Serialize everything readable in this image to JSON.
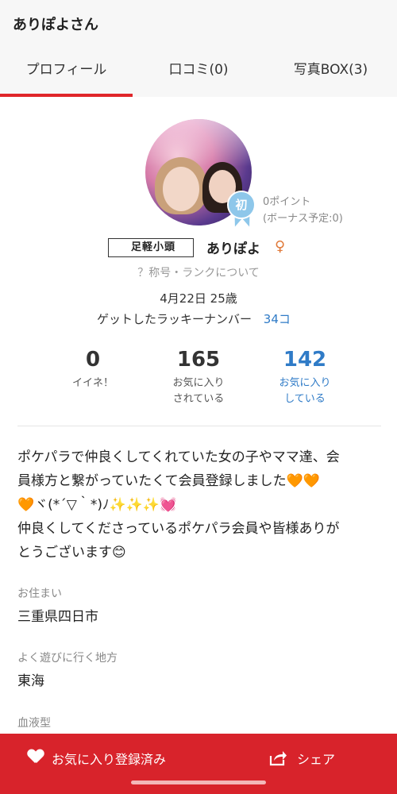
{
  "header": {
    "title": "ありぽよさん"
  },
  "tabs": [
    {
      "label": "プロフィール",
      "active": true
    },
    {
      "label": "口コミ(0)",
      "active": false
    },
    {
      "label": "写真BOX(3)",
      "active": false
    }
  ],
  "profile": {
    "badge_char": "初",
    "points": "0ポイント",
    "bonus": "(ボーナス予定:0)",
    "title_badge": "足軽小頭",
    "username": "ありぽよ",
    "gender_icon": "female-icon",
    "rank_info": "？称号・ランクについて",
    "birth": "4月22日 25歳",
    "lucky_label": "ゲットしたラッキーナンバー",
    "lucky_value": "34コ"
  },
  "stats": [
    {
      "num": "0",
      "label_line1": "イイネ！",
      "label_line2": ""
    },
    {
      "num": "165",
      "label_line1": "お気に入り",
      "label_line2": "されている"
    },
    {
      "num": "142",
      "label_line1": "お気に入り",
      "label_line2": "している"
    }
  ],
  "bio": {
    "line1": "ポケパラで仲良くしてくれていた女の子やママ達、会",
    "line2": "員様方と繋がっていたくて会員登録しました🧡🧡",
    "line3": "🧡ヾ(*´▽｀*)ﾉ✨✨✨💓",
    "line4": "仲良くしてくださっているポケパラ会員や皆様ありが",
    "line5": "とうございます😊"
  },
  "info": {
    "residence_label": "お住まい",
    "residence_value": "三重県四日市",
    "area_label": "よく遊びに行く地方",
    "area_value": "東海",
    "blood_label": "血液型"
  },
  "bottom": {
    "favorite_label": "お気に入り登録済み",
    "share_label": "シェア"
  },
  "colors": {
    "accent": "#d8232b",
    "link": "#2f7bc7"
  }
}
